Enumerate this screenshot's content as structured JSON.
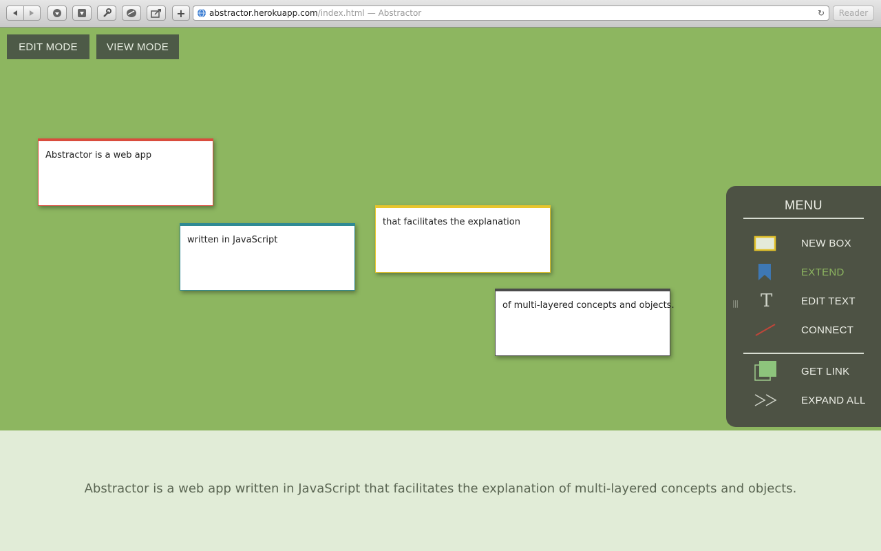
{
  "browser": {
    "url_host": "abstractor.herokuapp.com",
    "url_path": "/index.html",
    "page_title": "— Abstractor",
    "reader_label": "Reader",
    "new_tab_label": "+"
  },
  "modes": {
    "edit_label": "EDIT MODE",
    "view_label": "VIEW MODE"
  },
  "boxes": [
    {
      "text": "Abstractor is a web app",
      "color": "#d94c3d"
    },
    {
      "text": "written in JavaScript",
      "color": "#2f8a94"
    },
    {
      "text": "that facilitates the explanation",
      "color": "#e7c52c"
    },
    {
      "text": "of multi-layered concepts and objects.",
      "color": "#4b4b4b"
    }
  ],
  "menu": {
    "title": "MENU",
    "items": [
      {
        "label": "NEW BOX",
        "icon": "new-box-icon"
      },
      {
        "label": "EXTEND",
        "icon": "bookmark-icon",
        "active": true
      },
      {
        "label": "EDIT TEXT",
        "icon": "text-icon"
      },
      {
        "label": "CONNECT",
        "icon": "line-icon"
      },
      {
        "label": "GET LINK",
        "icon": "copy-icon"
      },
      {
        "label": "EXPAND ALL",
        "icon": "double-chevron-icon"
      }
    ]
  },
  "summary": {
    "text": "Abstractor is a web app written in JavaScript that facilitates the explanation of multi-layered concepts and objects."
  },
  "colors": {
    "canvas": "#8db660",
    "summary_bg": "#e1ecd7",
    "menu_bg": "#4d5244",
    "accent": "#8db660"
  }
}
